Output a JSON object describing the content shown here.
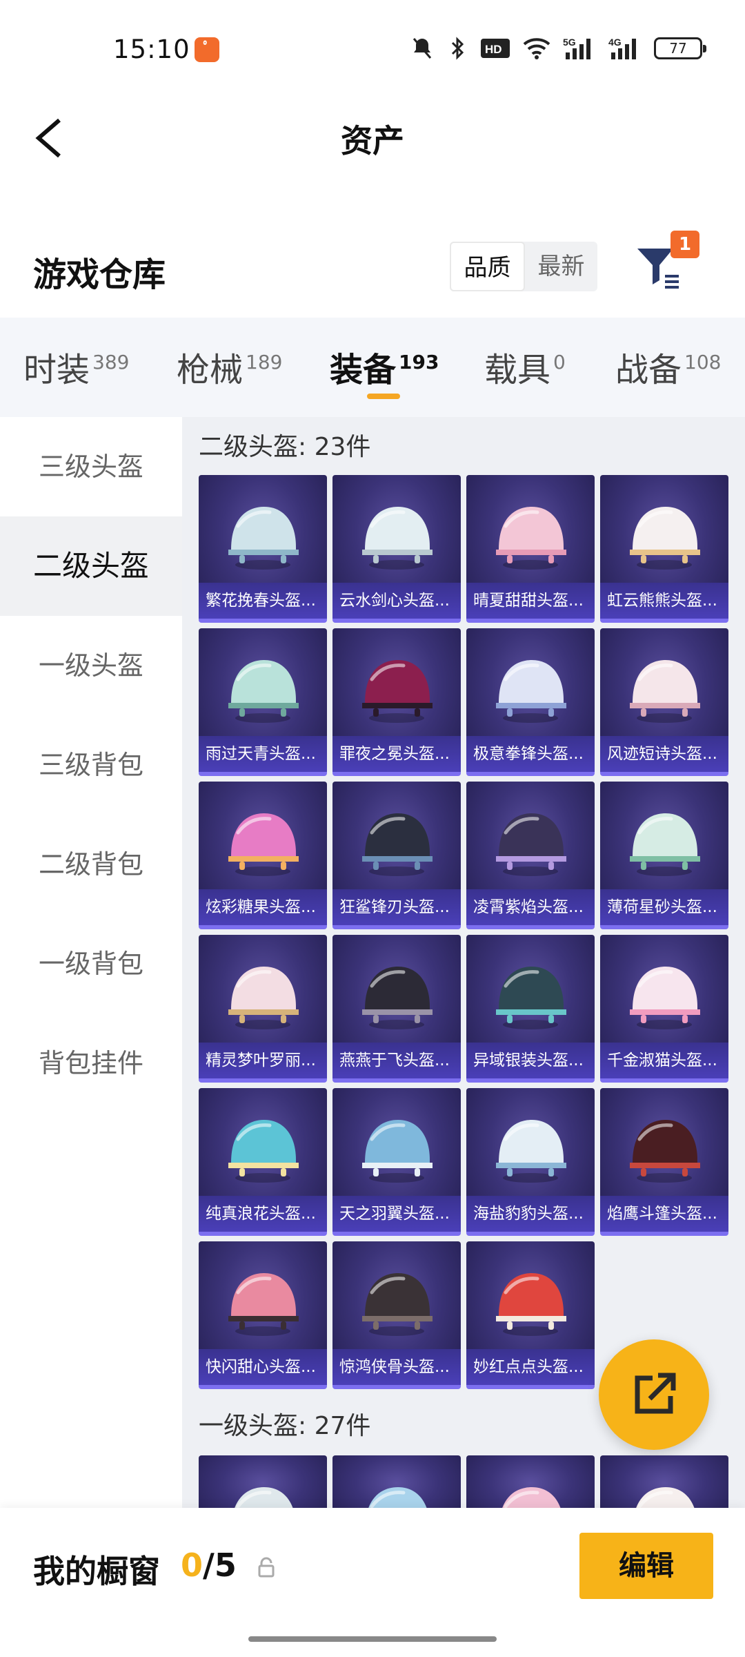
{
  "status_bar": {
    "time": "15:10",
    "app_icon": "app-notification-icon",
    "icons": [
      "mute-icon",
      "bluetooth-icon",
      "hd-icon",
      "wifi-icon",
      "5g-signal-icon",
      "4g-signal-icon"
    ],
    "battery": "77"
  },
  "header": {
    "title": "资产",
    "back_icon": "chevron-left-icon"
  },
  "warehouse": {
    "title": "游戏仓库",
    "sort_options": [
      "品质",
      "最新"
    ],
    "sort_active": "品质",
    "filter_badge": "1",
    "filter_icon": "filter-icon"
  },
  "tabs": [
    {
      "label": "时装",
      "count": "389"
    },
    {
      "label": "枪械",
      "count": "189"
    },
    {
      "label": "装备",
      "count": "193",
      "active": true
    },
    {
      "label": "载具",
      "count": "0"
    },
    {
      "label": "战备",
      "count": "108"
    }
  ],
  "sidebar": {
    "items": [
      "三级头盔",
      "二级头盔",
      "一级头盔",
      "三级背包",
      "二级背包",
      "一级背包",
      "背包挂件"
    ],
    "active": "二级头盔"
  },
  "sections": [
    {
      "title": "二级头盔: 23件",
      "items": [
        {
          "name": "繁花挽春头盔...",
          "color": "#cfe3ea",
          "accent": "#8fb7c9"
        },
        {
          "name": "云水剑心头盔...",
          "color": "#e3eef2",
          "accent": "#b9c9d0"
        },
        {
          "name": "晴夏甜甜头盔...",
          "color": "#f3c6d6",
          "accent": "#e79bb6"
        },
        {
          "name": "虹云熊熊头盔...",
          "color": "#f5f0f0",
          "accent": "#e8c48a"
        },
        {
          "name": "雨过天青头盔...",
          "color": "#b9e2da",
          "accent": "#6fa99d"
        },
        {
          "name": "罪夜之冕头盔...",
          "color": "#8c1f4e",
          "accent": "#2a1a2a"
        },
        {
          "name": "极意拳锋头盔...",
          "color": "#dfe4f5",
          "accent": "#8ea2d6"
        },
        {
          "name": "风迹短诗头盔...",
          "color": "#f5e6ea",
          "accent": "#d9a9b8"
        },
        {
          "name": "炫彩糖果头盔...",
          "color": "#e77cc5",
          "accent": "#f3b061"
        },
        {
          "name": "狂鲨锋刃头盔...",
          "color": "#2b2f3f",
          "accent": "#6b8fb5"
        },
        {
          "name": "凌霄紫焰头盔...",
          "color": "#3a3358",
          "accent": "#b49ae0"
        },
        {
          "name": "薄荷星砂头盔...",
          "color": "#d6ece4",
          "accent": "#7fbfa4"
        },
        {
          "name": "精灵梦叶罗丽...",
          "color": "#f3dde3",
          "accent": "#d6b37a"
        },
        {
          "name": "燕燕于飞头盔...",
          "color": "#2c2a36",
          "accent": "#9a93a8"
        },
        {
          "name": "异域银装头盔...",
          "color": "#2e4953",
          "accent": "#69c6c9"
        },
        {
          "name": "千金淑猫头盔...",
          "color": "#f7e5ee",
          "accent": "#f19cbf"
        },
        {
          "name": "纯真浪花头盔...",
          "color": "#5cc4d6",
          "accent": "#f3e2a0"
        },
        {
          "name": "天之羽翼头盔...",
          "color": "#7fb8dc",
          "accent": "#e8f0f6"
        },
        {
          "name": "海盐豹豹头盔...",
          "color": "#e4eef5",
          "accent": "#8bb6d6"
        },
        {
          "name": "焰鹰斗篷头盔...",
          "color": "#4a1e22",
          "accent": "#c8483d"
        },
        {
          "name": "快闪甜心头盔...",
          "color": "#e98aa0",
          "accent": "#3a2e33"
        },
        {
          "name": "惊鸿侠骨头盔...",
          "color": "#3a3236",
          "accent": "#7c6d6a"
        },
        {
          "name": "妙红点点头盔...",
          "color": "#e0463e",
          "accent": "#f3eadf"
        }
      ]
    },
    {
      "title": "一级头盔: 27件",
      "items": [
        {
          "color": "#dfe8ec",
          "accent": "#aebfc7"
        },
        {
          "color": "#a9d3ec",
          "accent": "#e9f3f8"
        },
        {
          "color": "#f2bfd3",
          "accent": "#e590b2"
        },
        {
          "color": "#f6efee",
          "accent": "#e3c9c3"
        }
      ]
    }
  ],
  "share_icon": "share-external-icon",
  "bottom": {
    "label": "我的橱窗",
    "count_current": "0",
    "count_total": "/5",
    "lock_icon": "lock-icon",
    "edit_label": "编辑"
  }
}
